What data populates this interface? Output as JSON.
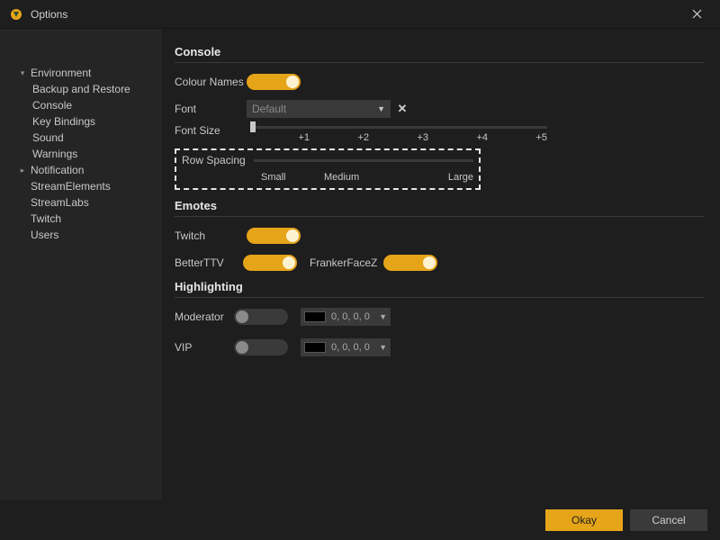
{
  "window": {
    "title": "Options"
  },
  "sidebar": {
    "items": [
      {
        "label": "Environment",
        "expanded": true,
        "children": [
          {
            "label": "Backup and Restore"
          },
          {
            "label": "Console"
          },
          {
            "label": "Key Bindings"
          },
          {
            "label": "Sound"
          },
          {
            "label": "Warnings"
          }
        ]
      },
      {
        "label": "Notification",
        "expanded": false
      },
      {
        "label": "StreamElements"
      },
      {
        "label": "StreamLabs"
      },
      {
        "label": "Twitch"
      },
      {
        "label": "Users"
      }
    ]
  },
  "sections": {
    "console": {
      "title": "Console",
      "colour_names_label": "Colour Names",
      "colour_names_on": true,
      "font_label": "Font",
      "font_value": "Default",
      "font_size_label": "Font Size",
      "font_size_ticks": [
        "",
        "+1",
        "+2",
        "+3",
        "+4",
        "+5"
      ],
      "row_spacing_label": "Row Spacing",
      "row_spacing_options": [
        "Small",
        "Medium",
        "Large"
      ]
    },
    "emotes": {
      "title": "Emotes",
      "twitch_label": "Twitch",
      "twitch_on": true,
      "betterttv_label": "BetterTTV",
      "betterttv_on": true,
      "ffz_label": "FrankerFaceZ",
      "ffz_on": true
    },
    "highlighting": {
      "title": "Highlighting",
      "moderator_label": "Moderator",
      "moderator_on": false,
      "moderator_color": "0, 0, 0, 0",
      "vip_label": "VIP",
      "vip_on": false,
      "vip_color": "0, 0, 0, 0"
    }
  },
  "footer": {
    "okay": "Okay",
    "cancel": "Cancel"
  }
}
